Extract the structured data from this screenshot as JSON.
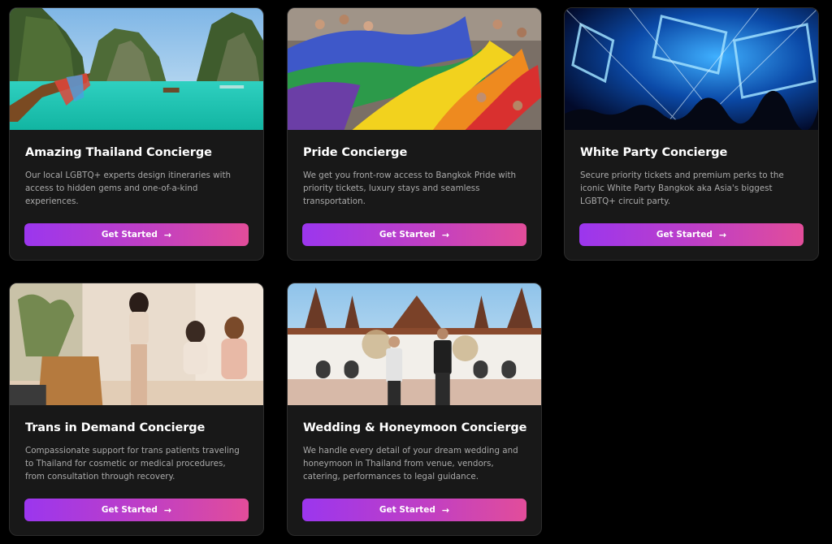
{
  "cards": [
    {
      "title": "Amazing Thailand Concierge",
      "description": "Our local LGBTQ+ experts design itineraries with access to hidden gems and one-of-a-kind experiences.",
      "button": "Get Started",
      "arrow_icon": "→"
    },
    {
      "title": "Pride Concierge",
      "description": "We get you front-row access to Bangkok Pride with priority tickets, luxury stays and seamless transportation.",
      "button": "Get Started",
      "arrow_icon": "→"
    },
    {
      "title": "White Party Concierge",
      "description": "Secure priority tickets and premium perks to the iconic White Party Bangkok aka Asia's biggest LGBTQ+ circuit party.",
      "button": "Get Started",
      "arrow_icon": "→"
    },
    {
      "title": "Trans in Demand Concierge",
      "description": "Compassionate support for trans patients traveling to Thailand for cosmetic or medical procedures, from consultation through recovery.",
      "button": "Get Started",
      "arrow_icon": "→"
    },
    {
      "title": "Wedding & Honeymoon Concierge",
      "description": "We handle every detail of your dream wedding and honeymoon in Thailand from venue, vendors, catering, performances to legal guidance.",
      "button": "Get Started",
      "arrow_icon": "→"
    }
  ],
  "colors": {
    "page_background": "#000000",
    "card_background": "#181818",
    "button_gradient_start": "#9b36ee",
    "button_gradient_end": "#e24d9a",
    "description_text": "#a9a9a9"
  }
}
